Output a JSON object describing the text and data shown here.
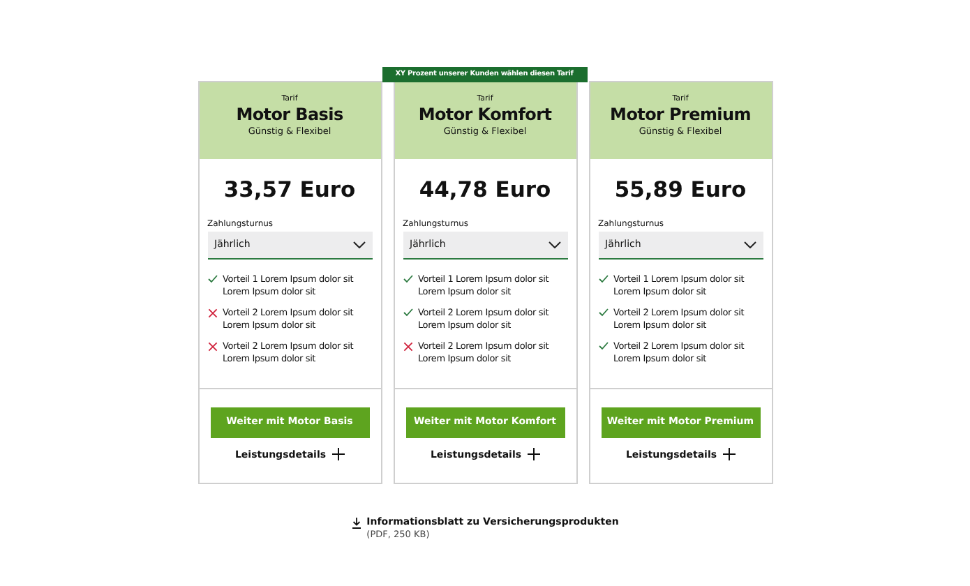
{
  "plans": [
    {
      "eyebrow": "Tarif",
      "name": "Motor Basis",
      "subtitle": "Günstig & Flexibel",
      "price": "33,57 Euro",
      "select_label": "Zahlungsturnus",
      "select_value": "Jährlich",
      "features": [
        {
          "text": "Vorteil 1 Lorem Ipsum dolor sit Lorem Ipsum dolor sit",
          "included": true
        },
        {
          "text": "Vorteil 2 Lorem Ipsum dolor sit Lorem Ipsum dolor sit",
          "included": false
        },
        {
          "text": "Vorteil 2 Lorem Ipsum dolor sit Lorem Ipsum dolor sit",
          "included": false
        }
      ],
      "button": "Weiter mit Motor Basis",
      "details": "Leistungsdetails"
    },
    {
      "highlight": "XY Prozent unserer Kunden wählen diesen Tarif",
      "eyebrow": "Tarif",
      "name": "Motor Komfort",
      "subtitle": "Günstig & Flexibel",
      "price": "44,78 Euro",
      "select_label": "Zahlungsturnus",
      "select_value": "Jährlich",
      "features": [
        {
          "text": "Vorteil 1 Lorem Ipsum dolor sit Lorem Ipsum dolor sit",
          "included": true
        },
        {
          "text": "Vorteil 2 Lorem Ipsum dolor sit Lorem Ipsum dolor sit",
          "included": true
        },
        {
          "text": "Vorteil 2 Lorem Ipsum dolor sit Lorem Ipsum dolor sit",
          "included": false
        }
      ],
      "button": "Weiter mit Motor Komfort",
      "details": "Leistungsdetails"
    },
    {
      "eyebrow": "Tarif",
      "name": "Motor Premium",
      "subtitle": "Günstig & Flexibel",
      "price": "55,89 Euro",
      "select_label": "Zahlungsturnus",
      "select_value": "Jährlich",
      "features": [
        {
          "text": "Vorteil 1 Lorem Ipsum dolor sit Lorem Ipsum dolor sit",
          "included": true
        },
        {
          "text": "Vorteil 2 Lorem Ipsum dolor sit Lorem Ipsum dolor sit",
          "included": true
        },
        {
          "text": "Vorteil 2 Lorem Ipsum dolor sit Lorem Ipsum dolor sit",
          "included": true
        }
      ],
      "button": "Weiter mit Motor Premium",
      "details": "Leistungsdetails"
    }
  ],
  "download": {
    "title": "Informationsblatt zu Versicherungsprodukten",
    "meta": "(PDF, 250 KB)"
  }
}
